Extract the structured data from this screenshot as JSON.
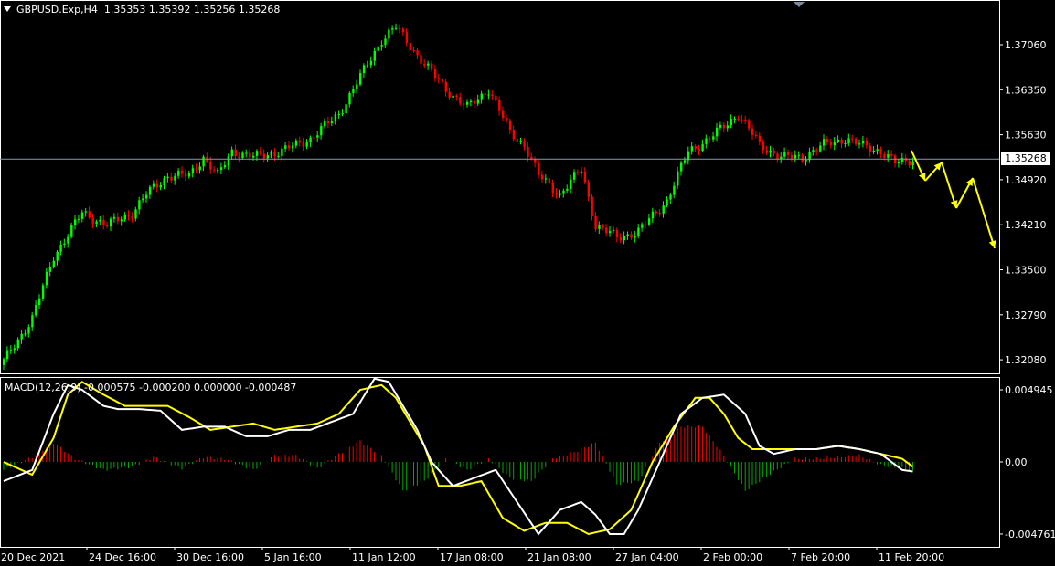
{
  "header": {
    "symbol": "GBPUSD.Exp,H4",
    "ohlc": "1.35353 1.35392 1.35256 1.35268"
  },
  "current_price_label": "1.35268",
  "macd_header": {
    "name": "MACD(12,26,9)",
    "values": "-0.000575 -0.000200 0.000000 -0.000487"
  },
  "colors": {
    "background": "#000000",
    "bull_candle": "#00ff00",
    "bear_candle": "#ff0000",
    "macd_line": "#ffffff",
    "signal_line": "#ffff00",
    "hist_positive": "#ff0000",
    "hist_negative": "#00aa00",
    "forecast_arrows": "#ffff00",
    "grid": "#ffffff"
  },
  "chart_data": [
    {
      "type": "candlestick",
      "symbol": "GBPUSD.Exp",
      "timeframe": "H4",
      "y_tick_labels": [
        "1.37060",
        "1.36350",
        "1.35630",
        "1.34920",
        "1.34210",
        "1.33500",
        "1.32790",
        "1.32080"
      ],
      "ylim": [
        1.3179,
        1.3781
      ],
      "current_price": 1.35268,
      "x_tick_labels": [
        "20 Dec 2021",
        "24 Dec 16:00",
        "30 Dec 16:00",
        "5 Jan 16:00",
        "11 Jan 12:00",
        "17 Jan 08:00",
        "21 Jan 08:00",
        "27 Jan 04:00",
        "2 Feb 00:00",
        "7 Feb 20:00",
        "11 Feb 20:00"
      ],
      "close_path": {
        "bars": [
          0,
          8,
          14,
          22,
          29,
          36,
          40,
          46,
          52,
          56,
          60,
          64,
          70,
          78,
          86,
          94,
          100,
          106,
          110,
          118,
          124,
          130,
          136,
          142,
          146,
          150,
          156,
          162,
          166,
          172,
          178,
          186,
          192,
          198,
          206,
          212,
          218,
          224,
          230,
          236,
          240,
          246,
          250,
          255
        ],
        "price": [
          1.32,
          1.327,
          1.337,
          1.344,
          1.342,
          1.344,
          1.347,
          1.35,
          1.35,
          1.353,
          1.35,
          1.354,
          1.353,
          1.354,
          1.356,
          1.36,
          1.366,
          1.372,
          1.374,
          1.368,
          1.364,
          1.361,
          1.364,
          1.357,
          1.355,
          1.35,
          1.347,
          1.351,
          1.342,
          1.34,
          1.341,
          1.346,
          1.354,
          1.356,
          1.36,
          1.355,
          1.353,
          1.353,
          1.355,
          1.356,
          1.355,
          1.354,
          1.352,
          1.3527
        ]
      }
    },
    {
      "type": "line",
      "title": "MACD(12,26,9)",
      "y_tick_labels": [
        "0.004945",
        "0.00",
        "-0.004761"
      ],
      "ylim": [
        -0.0053,
        0.0053
      ],
      "macd": {
        "bars": [
          0,
          8,
          14,
          18,
          22,
          28,
          32,
          38,
          44,
          50,
          56,
          62,
          68,
          74,
          80,
          86,
          92,
          98,
          104,
          108,
          112,
          116,
          120,
          126,
          132,
          138,
          144,
          150,
          156,
          162,
          166,
          170,
          174,
          178,
          184,
          190,
          196,
          202,
          208,
          212,
          216,
          222,
          228,
          234,
          240,
          246,
          252,
          255
        ],
        "values": [
          -0.0012,
          -0.0005,
          0.003,
          0.0048,
          0.0045,
          0.0035,
          0.0033,
          0.0033,
          0.0032,
          0.002,
          0.0022,
          0.0022,
          0.0016,
          0.0016,
          0.002,
          0.002,
          0.0025,
          0.003,
          0.0052,
          0.005,
          0.0035,
          0.002,
          0.0,
          -0.0015,
          -0.001,
          -0.0005,
          -0.0025,
          -0.0045,
          -0.003,
          -0.0025,
          -0.0033,
          -0.0045,
          -0.0045,
          -0.003,
          0.0,
          0.003,
          0.004,
          0.0042,
          0.003,
          0.001,
          0.0005,
          0.0008,
          0.0008,
          0.001,
          0.0008,
          0.0005,
          -0.0005,
          -0.0006
        ]
      },
      "signal": {
        "bars": [
          0,
          8,
          14,
          18,
          22,
          28,
          34,
          40,
          46,
          52,
          58,
          64,
          70,
          76,
          82,
          88,
          94,
          100,
          106,
          110,
          114,
          118,
          122,
          128,
          134,
          140,
          146,
          152,
          158,
          164,
          170,
          176,
          182,
          188,
          194,
          198,
          202,
          206,
          210,
          216,
          222,
          228,
          234,
          240,
          246,
          252,
          255
        ],
        "values": [
          0.0,
          -0.0008,
          0.0015,
          0.0042,
          0.005,
          0.0042,
          0.0035,
          0.0035,
          0.0035,
          0.0028,
          0.002,
          0.0022,
          0.0024,
          0.002,
          0.0022,
          0.0024,
          0.003,
          0.0045,
          0.0048,
          0.004,
          0.0025,
          0.001,
          -0.0015,
          -0.0015,
          -0.0012,
          -0.0035,
          -0.0043,
          -0.0038,
          -0.0038,
          -0.0045,
          -0.0042,
          -0.003,
          0.0,
          0.0022,
          0.004,
          0.004,
          0.003,
          0.0015,
          0.0008,
          0.0008,
          0.0008,
          0.0008,
          0.001,
          0.0008,
          0.0005,
          0.0002,
          -0.0003
        ]
      },
      "histogram": {
        "bars": [
          0,
          8,
          14,
          20,
          28,
          36,
          42,
          50,
          56,
          62,
          70,
          76,
          82,
          88,
          94,
          100,
          106,
          112,
          118,
          124,
          130,
          136,
          142,
          148,
          154,
          160,
          166,
          172,
          178,
          184,
          190,
          196,
          202,
          208,
          216,
          222,
          228,
          234,
          240,
          246,
          252,
          255
        ],
        "values": [
          -0.0005,
          0.0003,
          0.0012,
          0.0002,
          -0.0005,
          -0.0003,
          0.0003,
          -0.0004,
          0.0003,
          0.0002,
          -0.0005,
          0.0004,
          0.0004,
          -0.0004,
          0.0005,
          0.0013,
          0.0004,
          -0.0018,
          -0.0012,
          0.0002,
          -0.0005,
          0.0002,
          -0.001,
          -0.0012,
          0.0002,
          0.0006,
          0.0012,
          -0.0014,
          -0.0012,
          0.0012,
          0.0022,
          0.0022,
          0.0004,
          -0.0018,
          -0.0006,
          0.0002,
          0.0002,
          0.0003,
          0.0004,
          -0.0002,
          -0.0004,
          -0.0006
        ]
      }
    }
  ]
}
